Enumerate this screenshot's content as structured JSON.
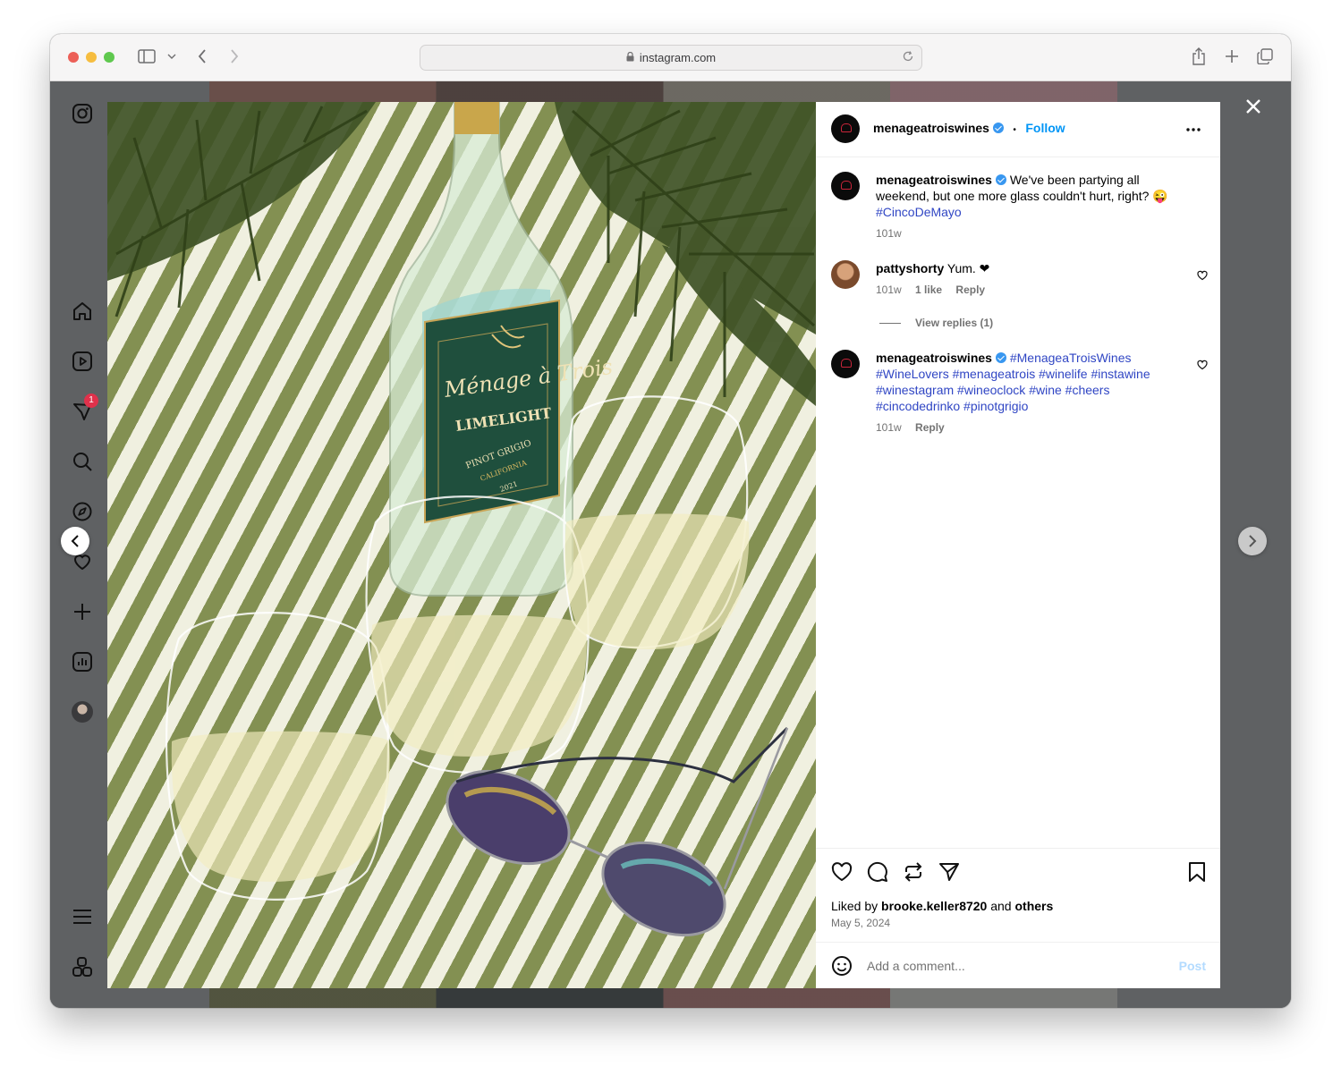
{
  "browser": {
    "url": "instagram.com",
    "traffic_lights": [
      "#ec5f57",
      "#f6bd3f",
      "#5fc84e"
    ]
  },
  "sidebar": {
    "notification_count": "1",
    "icons": [
      "instagram-logo-icon",
      "home-icon",
      "reels-icon",
      "messenger-icon",
      "search-icon",
      "explore-icon",
      "heart-icon",
      "create-icon",
      "dashboard-icon",
      "profile-avatar",
      "menu-icon",
      "threads-icon"
    ]
  },
  "post": {
    "author": "menageatroiswines",
    "follow_label": "Follow",
    "dot_separator": "•",
    "caption": {
      "author": "menageatroiswines",
      "text": "We've been partying all weekend, but one more glass couldn't hurt, right? 😜",
      "hashtag": "#CincoDeMayo",
      "time": "101w"
    },
    "comments": [
      {
        "author": "pattyshorty",
        "text": "Yum. ❤",
        "time": "101w",
        "likes": "1 like",
        "reply": "Reply",
        "view_replies": "View replies (1)"
      },
      {
        "author": "menageatroiswines",
        "hashtags": "#MenageaTroisWines #WineLovers #menageatrois #winelife #instawine #winestagram #wineoclock #wine #cheers #cincodedrinko #pinotgrigio",
        "time": "101w",
        "reply": "Reply"
      }
    ],
    "liked_by_prefix": "Liked by",
    "liked_by_user": "brooke.keller8720",
    "liked_by_and": "and",
    "liked_by_others": "others",
    "date": "May 5, 2024",
    "add_comment_placeholder": "Add a comment...",
    "post_label": "Post"
  },
  "photo_labels": {
    "brand": "Ménage à Trois",
    "wine": "LIMELIGHT",
    "varietal": "PINOT GRIGIO",
    "region": "CALIFORNIA",
    "vintage": "2021"
  },
  "colors": {
    "link_blue": "#0095f6",
    "hashtag_blue": "#3046c4",
    "badge_red": "#e0314b"
  }
}
